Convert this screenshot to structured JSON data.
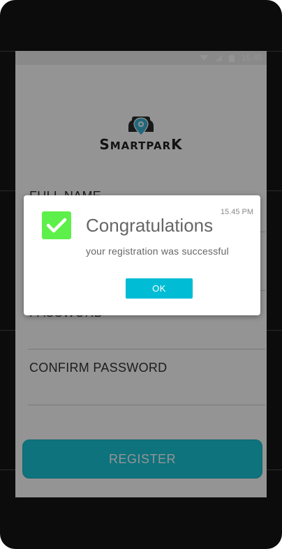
{
  "status_bar": {
    "time": "15:45",
    "icons": [
      "wifi-icon",
      "signal-icon",
      "battery-icon"
    ]
  },
  "app": {
    "logo_text_prefix": "S",
    "logo_text_middle": "MARTPAR",
    "logo_text_suffix": "K",
    "logo_icon": "car-location-icon",
    "fields": [
      {
        "label": "FULL NAME"
      },
      {
        "label": ""
      },
      {
        "label": "PASSWORD"
      },
      {
        "label": "CONFIRM PASSWORD"
      }
    ],
    "register_label": "REGISTER"
  },
  "dialog": {
    "time": "15.45 PM",
    "title": "Congratulations",
    "message": "your registration was successful",
    "ok_label": "OK",
    "icon": "checkmark-icon"
  },
  "colors": {
    "accent": "#19c6d8",
    "dialog_button": "#00bcd4",
    "check_green": "#5ef04a",
    "overlay": "rgba(0,0,0,0.42)"
  }
}
